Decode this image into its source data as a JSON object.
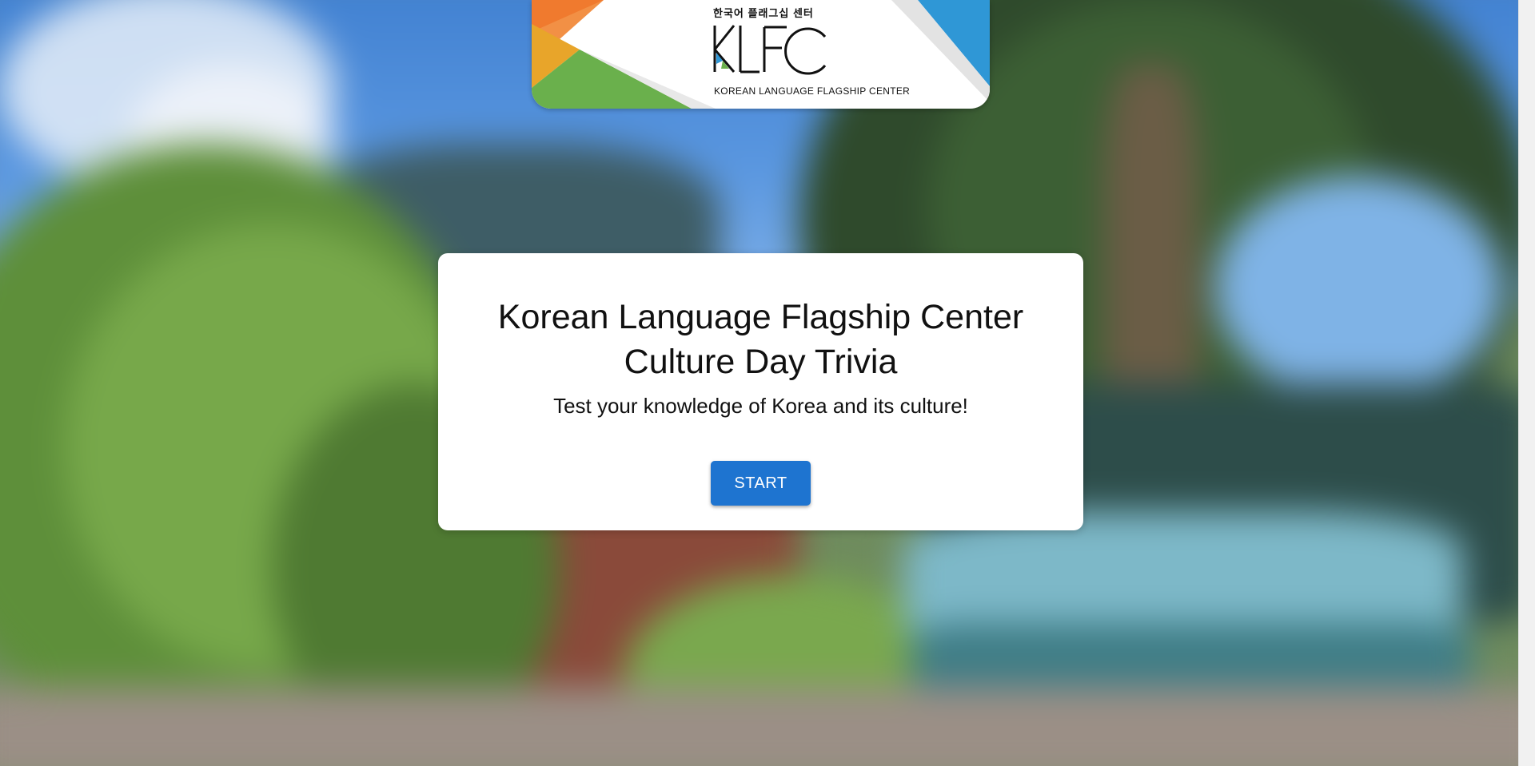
{
  "logo": {
    "korean_text": "한국어 플래그십 센터",
    "mark_text": "KLFC",
    "english_text": "KOREAN LANGUAGE FLAGSHIP CENTER",
    "colors": {
      "orange": "#f07a2e",
      "green": "#6ab04c",
      "blue": "#2f97d6",
      "yellow": "#e8a52a"
    }
  },
  "card": {
    "title_line1": "Korean Language Flagship Center",
    "title_line2": "Culture Day Trivia",
    "subtitle": "Test your knowledge of Korea and its culture!",
    "start_label": "START",
    "button_color": "#1e74d0"
  }
}
